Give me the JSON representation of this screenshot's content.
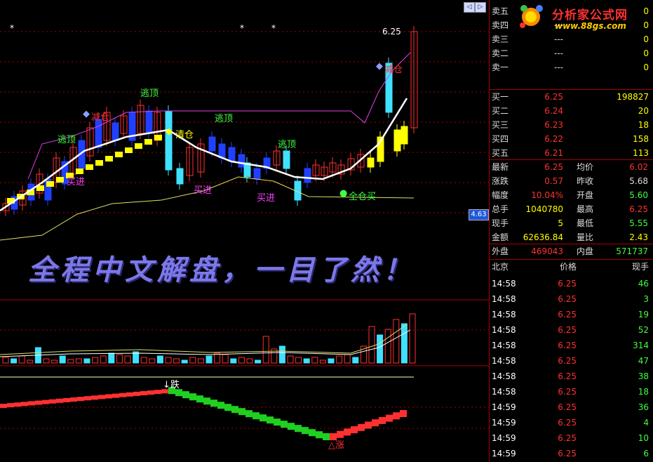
{
  "logo": {
    "name": "分析家公式网",
    "url": "www.88gs.com"
  },
  "banner": "全程中文解盘，一目了然！",
  "chart": {
    "top_price_label": "6.25",
    "current_price_tag": "4.63",
    "signals": {
      "escape_top_1": "逃顶",
      "escape_top_2": "逃顶",
      "escape_top_3": "逃顶",
      "escape_top_4": "逃顶",
      "reduce_1": "减仓",
      "reduce_2": "减仓",
      "clear": "清仓",
      "buy_1": "买进",
      "buy_2": "买进",
      "buy_3": "买进",
      "full_buy": "全仓买",
      "fall": "↓跌",
      "rise": "△涨"
    },
    "colors": {
      "up": "#ff3030",
      "down": "#40e0ff",
      "signal_yellow": "#ffff00",
      "ma_white": "#ffffff",
      "ma_magenta": "#e040e0"
    }
  },
  "quote": {
    "sell": [
      {
        "label": "卖五",
        "price": "",
        "vol": "0"
      },
      {
        "label": "卖四",
        "price": "---",
        "vol": "0"
      },
      {
        "label": "卖三",
        "price": "---",
        "vol": "0"
      },
      {
        "label": "卖二",
        "price": "---",
        "vol": "0"
      },
      {
        "label": "卖一",
        "price": "---",
        "vol": "0"
      }
    ],
    "buy": [
      {
        "label": "买一",
        "price": "6.25",
        "vol": "198827"
      },
      {
        "label": "买二",
        "price": "6.24",
        "vol": "20"
      },
      {
        "label": "买三",
        "price": "6.23",
        "vol": "18"
      },
      {
        "label": "买四",
        "price": "6.22",
        "vol": "158"
      },
      {
        "label": "买五",
        "price": "6.21",
        "vol": "113"
      }
    ],
    "stats": [
      {
        "l1": "最新",
        "v1": "6.25",
        "c1": "#ff3030",
        "l2": "均价",
        "v2": "6.02",
        "c2": "#ff3030"
      },
      {
        "l1": "涨跌",
        "v1": "0.57",
        "c1": "#ff3030",
        "l2": "昨收",
        "v2": "5.68",
        "c2": "#dddddd"
      },
      {
        "l1": "幅度",
        "v1": "10.04%",
        "c1": "#ff3030",
        "l2": "开盘",
        "v2": "5.60",
        "c2": "#40ff40"
      },
      {
        "l1": "总手",
        "v1": "1040780",
        "c1": "#ffff00",
        "l2": "最高",
        "v2": "6.25",
        "c2": "#ff3030"
      },
      {
        "l1": "现手",
        "v1": "5",
        "c1": "#ffff00",
        "l2": "最低",
        "v2": "5.55",
        "c2": "#40ff40"
      },
      {
        "l1": "金额",
        "v1": "62636.84",
        "c1": "#ffff00",
        "l2": "量比",
        "v2": "2.43",
        "c2": "#ffff00"
      }
    ],
    "outer_label": "外盘",
    "outer_value": "469043",
    "inner_label": "内盘",
    "inner_value": "571737"
  },
  "ticks": {
    "headers": {
      "market": "北京",
      "price": "价格",
      "volume": "现手"
    },
    "rows": [
      {
        "time": "14:58",
        "price": "6.25",
        "vol": "46"
      },
      {
        "time": "14:58",
        "price": "6.25",
        "vol": "3"
      },
      {
        "time": "14:58",
        "price": "6.25",
        "vol": "19"
      },
      {
        "time": "14:58",
        "price": "6.25",
        "vol": "52"
      },
      {
        "time": "14:58",
        "price": "6.25",
        "vol": "314"
      },
      {
        "time": "14:58",
        "price": "6.25",
        "vol": "47"
      },
      {
        "time": "14:58",
        "price": "6.25",
        "vol": "38"
      },
      {
        "time": "14:58",
        "price": "6.25",
        "vol": "18"
      },
      {
        "time": "14:59",
        "price": "6.25",
        "vol": "36"
      },
      {
        "time": "14:59",
        "price": "6.25",
        "vol": "4"
      },
      {
        "time": "14:59",
        "price": "6.25",
        "vol": "10"
      },
      {
        "time": "14:59",
        "price": "6.25",
        "vol": "6"
      }
    ]
  }
}
